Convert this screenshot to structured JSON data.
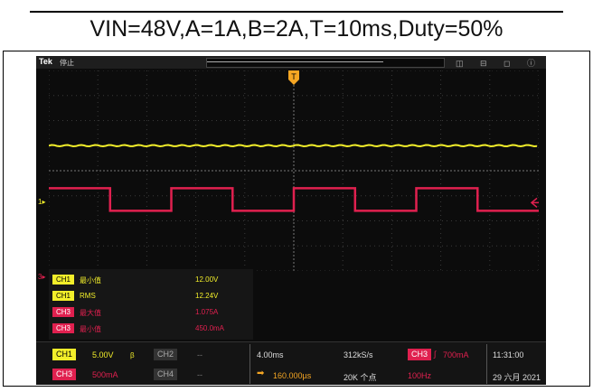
{
  "title": "VIN=48V,A=1A,B=2A,T=10ms,Duty=50%",
  "scope": {
    "brand": "Tek",
    "status": "停止",
    "trigger_marker": "T",
    "ch1_marker": "1",
    "ch3_marker": "3",
    "top_icons": "◫ ⊟ ◻ ⓘ"
  },
  "measurements": [
    {
      "channel": "CH1",
      "label": "最小值",
      "value": "12.00V",
      "color": "#f2ee2a"
    },
    {
      "channel": "CH1",
      "label": "RMS",
      "value": "12.24V",
      "color": "#f2ee2a"
    },
    {
      "channel": "CH3",
      "label": "最大值",
      "value": "1.075A",
      "color": "#e0204f"
    },
    {
      "channel": "CH3",
      "label": "最小值",
      "value": "450.0mA",
      "color": "#e0204f"
    }
  ],
  "bottom": {
    "ch1_label": "CH1",
    "ch1_scale": "5.00V",
    "ch1_bw": "β",
    "ch2_label": "CH2",
    "ch2_scale": "--",
    "ch3_label": "CH3",
    "ch3_scale": "500mA",
    "ch4_label": "CH4",
    "ch4_scale": "--",
    "timebase": "4.00ms",
    "sample_rate": "312kS/s",
    "delay": "160.000µs",
    "record_length": "20K 个点",
    "trig_source": "CH3",
    "trig_level": "700mA",
    "trig_freq": "100Hz",
    "time": "11:31:00",
    "date": "29 六月 2021"
  },
  "colors": {
    "ch1": "#f2ee2a",
    "ch3": "#e0204f",
    "screen": "#0c0c0c",
    "trigger": "#f5a623"
  },
  "waveform": {
    "ch1_level_div": 3.0,
    "ch3_high_div": 4.7,
    "ch3_low_div": 5.6,
    "period_ms": 10,
    "duty": 0.5,
    "ms_per_div": 4
  }
}
